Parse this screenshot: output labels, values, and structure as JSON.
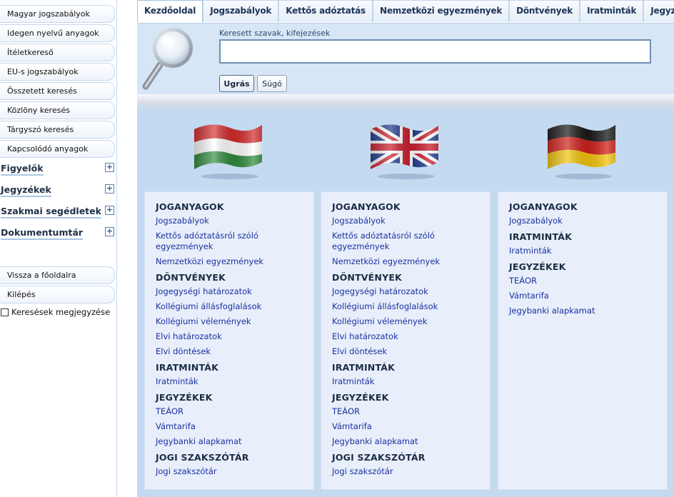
{
  "sidebar": {
    "buttons": [
      {
        "label": "Magyar jogszabályok"
      },
      {
        "label": "Idegen nyelvű anyagok"
      },
      {
        "label": "Ítéletkereső"
      },
      {
        "label": "EU-s jogszabályok"
      },
      {
        "label": "Összetett keresés"
      },
      {
        "label": "Közlöny keresés"
      },
      {
        "label": "Tárgyszó keresés"
      },
      {
        "label": "Kapcsolódó anyagok"
      }
    ],
    "sections": [
      {
        "label": "Figyelők"
      },
      {
        "label": "Jegyzékek"
      },
      {
        "label": "Szakmai segédletek"
      },
      {
        "label": "Dokumentumtár"
      }
    ],
    "expand_glyph": "+",
    "bottom_buttons": [
      {
        "label": "Vissza a főoldalra"
      },
      {
        "label": "Kilépés"
      }
    ],
    "remember_label": "Keresések megjegyzése"
  },
  "tabs": [
    {
      "label": "Kezdőoldal",
      "active": true
    },
    {
      "label": "Jogszabályok"
    },
    {
      "label": "Kettős adóztatás"
    },
    {
      "label": "Nemzetközi egyezmények"
    },
    {
      "label": "Döntvények"
    },
    {
      "label": "Iratminták"
    },
    {
      "label": "Jegyzékek"
    }
  ],
  "search": {
    "label": "Keresett szavak, kifejezések",
    "value": "",
    "go_label": "Ugrás",
    "help_label": "Súgó"
  },
  "flags": [
    {
      "country": "hungary",
      "icon": "hungarian-flag-icon"
    },
    {
      "country": "uk",
      "icon": "uk-flag-icon"
    },
    {
      "country": "germany",
      "icon": "german-flag-icon"
    }
  ],
  "panels": [
    {
      "items": [
        {
          "type": "head",
          "text": "JOGANYAGOK"
        },
        {
          "type": "link",
          "text": "Jogszabályok"
        },
        {
          "type": "link",
          "text": "Kettős adóztatásról szóló egyezmények"
        },
        {
          "type": "link",
          "text": "Nemzetközi egyezmények"
        },
        {
          "type": "head",
          "text": "DÖNTVÉNYEK"
        },
        {
          "type": "link",
          "text": "Jogegységi határozatok"
        },
        {
          "type": "link",
          "text": "Kollégiumi állásfoglalások"
        },
        {
          "type": "link",
          "text": "Kollégiumi vélemények"
        },
        {
          "type": "link",
          "text": "Elvi határozatok"
        },
        {
          "type": "link",
          "text": "Elvi döntések"
        },
        {
          "type": "head",
          "text": "IRATMINTÁK"
        },
        {
          "type": "link",
          "text": "Iratminták"
        },
        {
          "type": "head",
          "text": "JEGYZÉKEK"
        },
        {
          "type": "link",
          "text": "TEÁOR"
        },
        {
          "type": "link",
          "text": "Vámtarifa"
        },
        {
          "type": "link",
          "text": "Jegybanki alapkamat"
        },
        {
          "type": "head",
          "text": "JOGI SZAKSZÓTÁR"
        },
        {
          "type": "link",
          "text": "Jogi szakszótár"
        }
      ]
    },
    {
      "items": [
        {
          "type": "head",
          "text": "JOGANYAGOK"
        },
        {
          "type": "link",
          "text": "Jogszabályok"
        },
        {
          "type": "link",
          "text": "Kettős adóztatásról szóló egyezmények"
        },
        {
          "type": "link",
          "text": "Nemzetközi egyezmények"
        },
        {
          "type": "head",
          "text": "DÖNTVÉNYEK"
        },
        {
          "type": "link",
          "text": "Jogegységi határozatok"
        },
        {
          "type": "link",
          "text": "Kollégiumi állásfoglalások"
        },
        {
          "type": "link",
          "text": "Kollégiumi vélemények"
        },
        {
          "type": "link",
          "text": "Elvi határozatok"
        },
        {
          "type": "link",
          "text": "Elvi döntések"
        },
        {
          "type": "head",
          "text": "IRATMINTÁK"
        },
        {
          "type": "link",
          "text": "Iratminták"
        },
        {
          "type": "head",
          "text": "JEGYZÉKEK"
        },
        {
          "type": "link",
          "text": "TEÁOR"
        },
        {
          "type": "link",
          "text": "Vámtarifa"
        },
        {
          "type": "link",
          "text": "Jegybanki alapkamat"
        },
        {
          "type": "head",
          "text": "JOGI SZAKSZÓTÁR"
        },
        {
          "type": "link",
          "text": "Jogi szakszótár"
        }
      ]
    },
    {
      "items": [
        {
          "type": "head",
          "text": "JOGANYAGOK"
        },
        {
          "type": "link",
          "text": "Jogszabályok"
        },
        {
          "type": "head",
          "text": "IRATMINTÁK"
        },
        {
          "type": "link",
          "text": "Iratminták"
        },
        {
          "type": "head",
          "text": "JEGYZÉKEK"
        },
        {
          "type": "link",
          "text": "TEÁOR"
        },
        {
          "type": "link",
          "text": "Vámtarifa"
        },
        {
          "type": "link",
          "text": "Jegybanki alapkamat"
        }
      ]
    }
  ],
  "colors": {
    "link": "#1c2fa0",
    "heading": "#1c2c44",
    "main_bg": "#c4daf1",
    "panel_bg": "#e8effb"
  }
}
